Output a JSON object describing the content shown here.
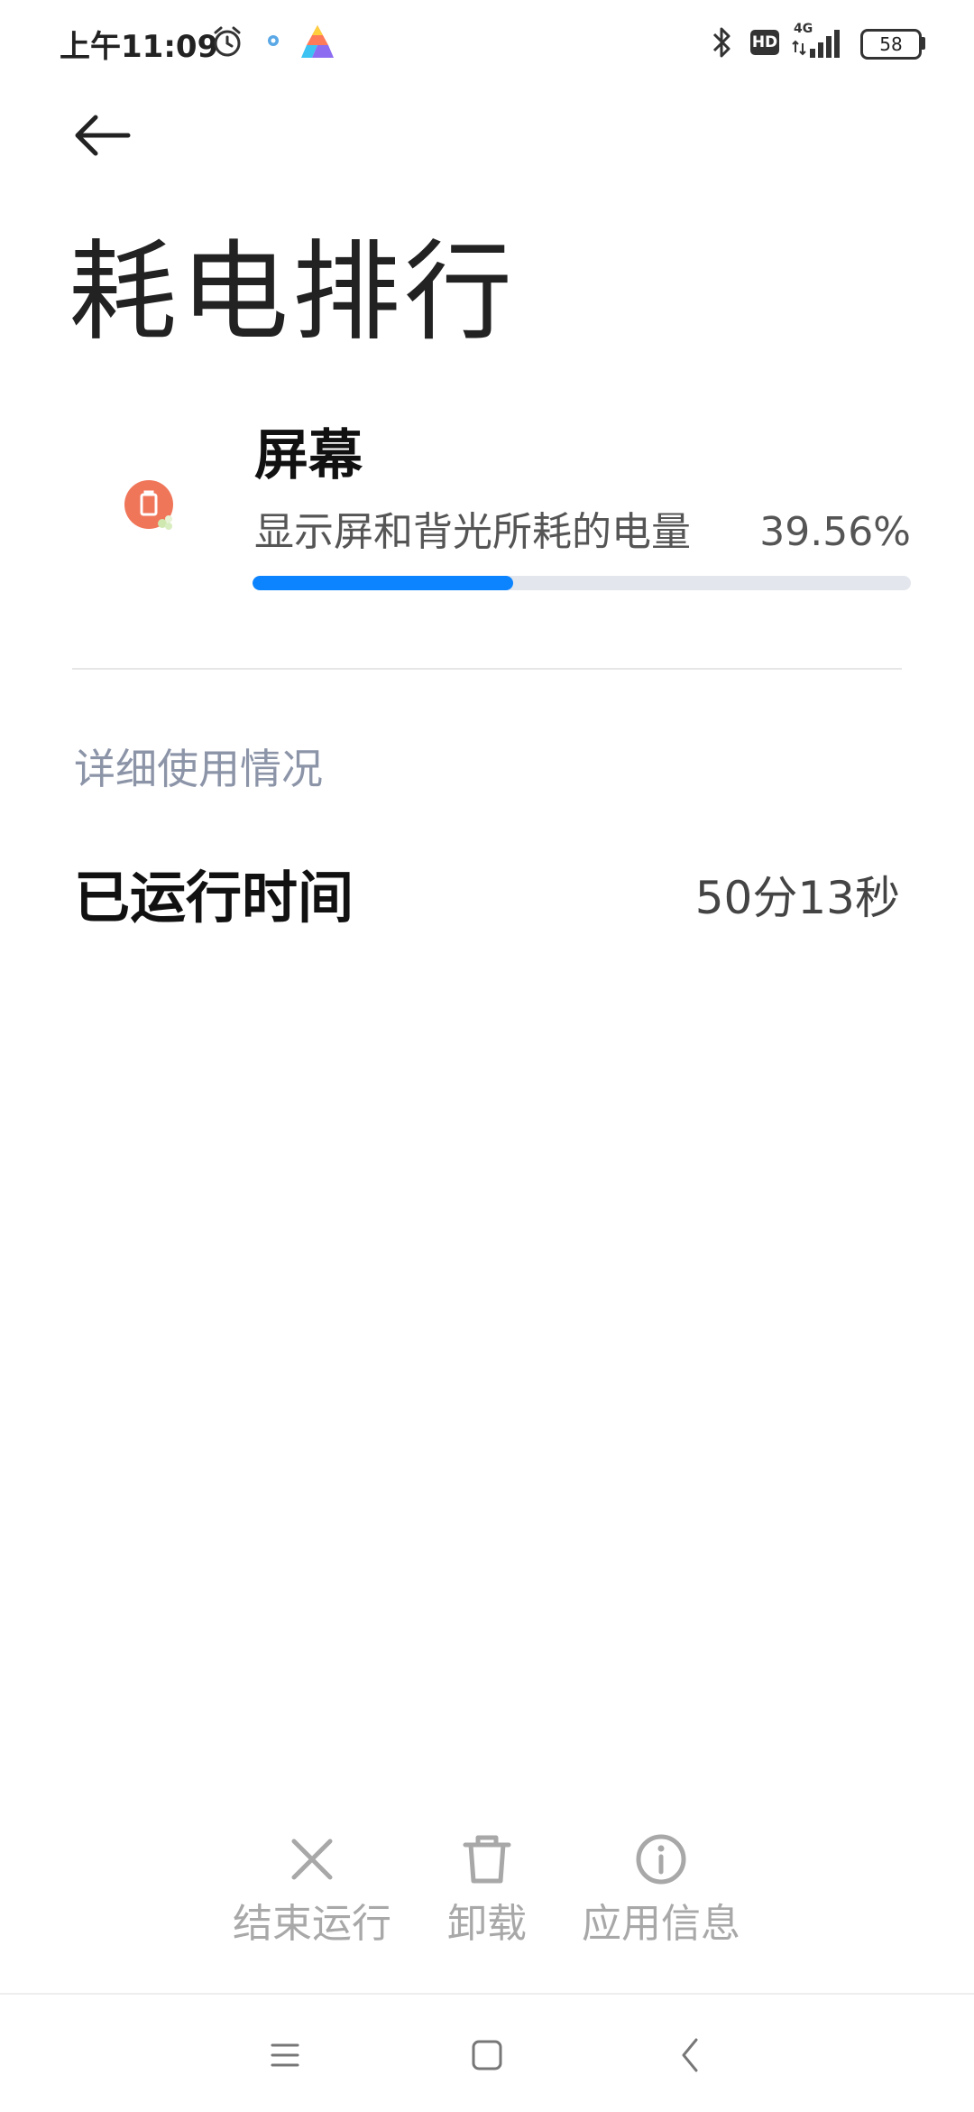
{
  "status_bar": {
    "time": "上午11:09",
    "network": "4G",
    "hd": "HD",
    "battery": "58",
    "icons": [
      "alarm-icon",
      "app-notification-icon",
      "bluetooth-icon",
      "signal-icon",
      "battery-icon"
    ]
  },
  "header": {
    "back_icon": "arrow-left-icon",
    "title": "耗电排行"
  },
  "item": {
    "icon": "screen-icon",
    "icon_color": "#f0765a",
    "title": "屏幕",
    "subtitle": "显示屏和背光所耗的电量",
    "percent_label": "39.56%",
    "percent_value": 39.56
  },
  "details": {
    "section_title": "详细使用情况",
    "rows": [
      {
        "label": "已运行时间",
        "value": "50分13秒"
      }
    ]
  },
  "actions": [
    {
      "label": "结束运行",
      "icon": "close-icon"
    },
    {
      "label": "卸载",
      "icon": "trash-icon"
    },
    {
      "label": "应用信息",
      "icon": "info-icon"
    }
  ],
  "nav": {
    "items": [
      "menu-icon",
      "home-icon",
      "back-icon"
    ]
  },
  "colors": {
    "accent": "#0d84ff",
    "track": "#e3e6ec",
    "section_text": "#8c94a8",
    "disabled_action": "#a8a8a8"
  }
}
